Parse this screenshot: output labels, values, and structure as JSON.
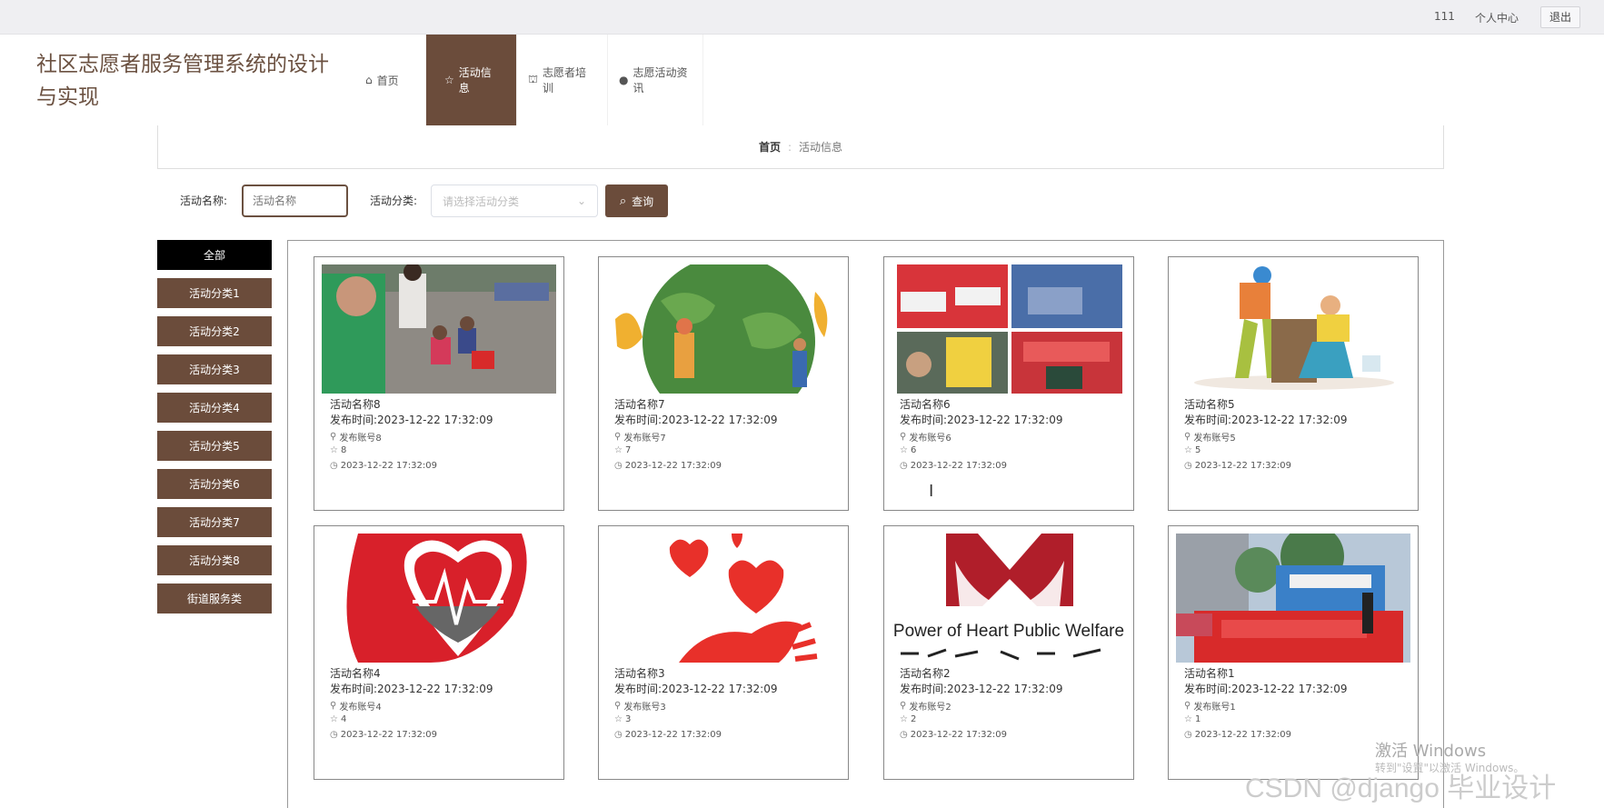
{
  "topbar": {
    "user": "111",
    "center": "个人中心",
    "logout": "退出"
  },
  "header": {
    "title": "社区志愿者服务管理系统的设计与实现"
  },
  "nav": [
    {
      "icon": "⌂",
      "label": "首页"
    },
    {
      "icon": "☆",
      "label": "活动信息"
    },
    {
      "icon": "⛫",
      "label": "志愿者培训"
    },
    {
      "icon": "●",
      "label": "志愿活动资讯"
    }
  ],
  "breadcrumb": {
    "home": "首页",
    "current": "活动信息"
  },
  "search": {
    "name_label": "活动名称:",
    "name_placeholder": "活动名称",
    "category_label": "活动分类:",
    "category_placeholder": "请选择活动分类",
    "query_label": "查询"
  },
  "categories": [
    "全部",
    "活动分类1",
    "活动分类2",
    "活动分类3",
    "活动分类4",
    "活动分类5",
    "活动分类6",
    "活动分类7",
    "活动分类8",
    "街道服务类"
  ],
  "cards": [
    {
      "name": "活动名称8",
      "publish": "发布时间:2023-12-22 17:32:09",
      "account": "发布账号8",
      "likes": "8",
      "time": "2023-12-22 17:32:09"
    },
    {
      "name": "活动名称7",
      "publish": "发布时间:2023-12-22 17:32:09",
      "account": "发布账号7",
      "likes": "7",
      "time": "2023-12-22 17:32:09"
    },
    {
      "name": "活动名称6",
      "publish": "发布时间:2023-12-22 17:32:09",
      "account": "发布账号6",
      "likes": "6",
      "time": "2023-12-22 17:32:09"
    },
    {
      "name": "活动名称5",
      "publish": "发布时间:2023-12-22 17:32:09",
      "account": "发布账号5",
      "likes": "5",
      "time": "2023-12-22 17:32:09"
    },
    {
      "name": "活动名称4",
      "publish": "发布时间:2023-12-22 17:32:09",
      "account": "发布账号4",
      "likes": "4",
      "time": "2023-12-22 17:32:09"
    },
    {
      "name": "活动名称3",
      "publish": "发布时间:2023-12-22 17:32:09",
      "account": "发布账号3",
      "likes": "3",
      "time": "2023-12-22 17:32:09"
    },
    {
      "name": "活动名称2",
      "publish": "发布时间:2023-12-22 17:32:09",
      "account": "发布账号2",
      "likes": "2",
      "time": "2023-12-22 17:32:09"
    },
    {
      "name": "活动名称1",
      "publish": "发布时间:2023-12-22 17:32:09",
      "account": "发布账号1",
      "likes": "1",
      "time": "2023-12-22 17:32:09"
    }
  ],
  "card6_image_text": "Power of Heart Public Welfare",
  "watermark": {
    "activate": "激活 Windows",
    "activate_hint": "转到\"设置\"以激活 Windows。",
    "csdn": "CSDN @django 毕业设计"
  },
  "colors": {
    "accent": "#6b4c3b",
    "title": "#6b5141",
    "active_category": "#000000"
  }
}
